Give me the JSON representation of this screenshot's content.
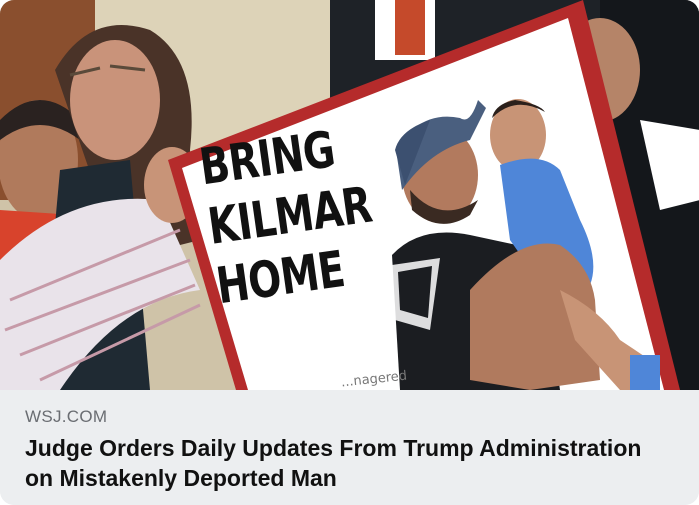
{
  "link_preview": {
    "image": {
      "sign_lines": [
        "BRING",
        "KILMAR",
        "HOME"
      ],
      "sign_caption": "...nagered"
    },
    "source": "WSJ.COM",
    "headline": "Judge Orders Daily Updates From Trump Administration on Mistakenly Deported Man"
  },
  "colors": {
    "sign_border": "#b52b2b",
    "footer_bg": "#eceef0",
    "source_text": "#6a6d72",
    "headline_text": "#111111"
  }
}
